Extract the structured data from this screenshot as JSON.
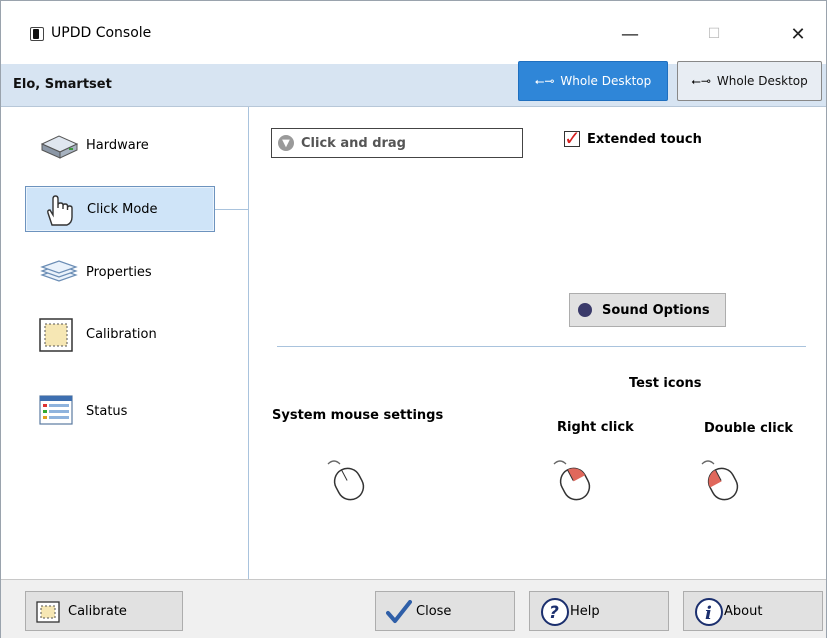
{
  "window": {
    "title": "UPDD Console",
    "minimize_glyph": "—",
    "maximize_glyph": "☐",
    "close_glyph": "✕"
  },
  "header": {
    "device_label": "Elo, Smartset",
    "desktop_buttons": [
      {
        "label": "Whole Desktop",
        "icon": "usb-icon",
        "active": true
      },
      {
        "label": "Whole Desktop",
        "icon": "usb-icon",
        "active": false
      }
    ]
  },
  "sidebar": {
    "items": [
      {
        "label": "Hardware",
        "icon": "hardware-drive-icon",
        "selected": false
      },
      {
        "label": "Click Mode",
        "icon": "hand-pointer-icon",
        "selected": true
      },
      {
        "label": "Properties",
        "icon": "layers-icon",
        "selected": false
      },
      {
        "label": "Calibration",
        "icon": "calibration-icon",
        "selected": false
      },
      {
        "label": "Status",
        "icon": "status-table-icon",
        "selected": false
      }
    ]
  },
  "click_mode": {
    "mode_select_value": "Click and drag",
    "extended_touch_label": "Extended touch",
    "extended_touch_checked": true,
    "sound_options_label": "Sound Options",
    "test_icons_heading": "Test icons",
    "system_mouse_label": "System mouse settings",
    "right_click_label": "Right click",
    "double_click_label": "Double click"
  },
  "footer": {
    "calibrate_label": "Calibrate",
    "close_label": "Close",
    "help_label": "Help",
    "about_label": "About"
  },
  "colors": {
    "header_bg": "#d7e4f2",
    "active_button": "#2f86d8",
    "selected_nav": "#cfe4f8",
    "checkmark": "#d61f1f"
  }
}
